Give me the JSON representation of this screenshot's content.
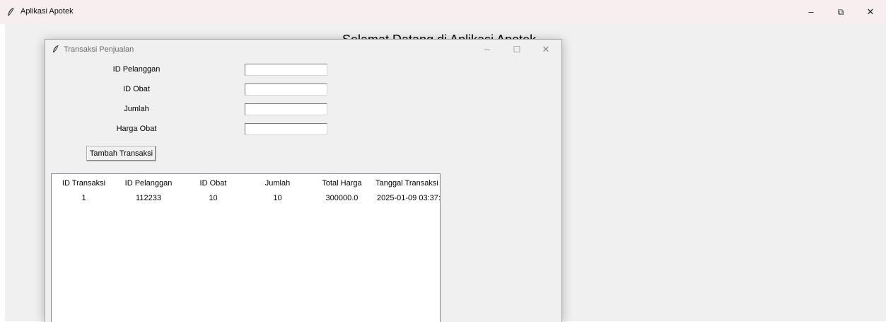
{
  "main_window": {
    "title": "Aplikasi Apotek",
    "heading": "Selamat Datang di Aplikasi Apotek",
    "controls": {
      "minimize": "–",
      "restore": "⧉",
      "close": "✕"
    }
  },
  "dialog": {
    "title": "Transaksi Penjualan",
    "controls": {
      "minimize": "–",
      "maximize": "☐",
      "close": "✕"
    },
    "form": {
      "fields": [
        {
          "label": "ID Pelanggan",
          "value": ""
        },
        {
          "label": "ID Obat",
          "value": ""
        },
        {
          "label": "Jumlah",
          "value": ""
        },
        {
          "label": "Harga Obat",
          "value": ""
        }
      ],
      "submit_label": "Tambah Transaksi"
    },
    "table": {
      "columns": [
        "ID Transaksi",
        "ID Pelanggan",
        "ID Obat",
        "Jumlah",
        "Total Harga",
        "Tanggal Transaksi"
      ],
      "rows": [
        [
          "1",
          "112233",
          "10",
          "10",
          "300000.0",
          "2025-01-09 03:37:"
        ]
      ]
    }
  }
}
